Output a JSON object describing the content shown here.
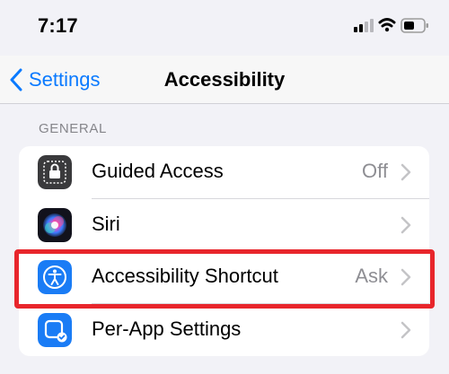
{
  "status_bar": {
    "time": "7:17"
  },
  "nav": {
    "back_label": "Settings",
    "title": "Accessibility"
  },
  "section": {
    "header": "GENERAL"
  },
  "rows": [
    {
      "label": "Guided Access",
      "value": "Off",
      "icon": "guided-access-icon",
      "icon_color": "#3a3a3c"
    },
    {
      "label": "Siri",
      "value": "",
      "icon": "siri-icon",
      "icon_color": "#1c1c2e"
    },
    {
      "label": "Accessibility Shortcut",
      "value": "Ask",
      "icon": "accessibility-icon",
      "icon_color": "#1a7cf5"
    },
    {
      "label": "Per-App Settings",
      "value": "",
      "icon": "per-app-settings-icon",
      "icon_color": "#1a7cf5"
    }
  ],
  "colors": {
    "accent": "#0a7aff",
    "highlight": "#e8262c",
    "background": "#f2f2f7"
  }
}
